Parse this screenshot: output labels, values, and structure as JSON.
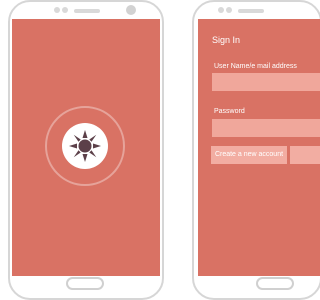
{
  "splash": {
    "logo_icon": "sun-icon"
  },
  "signin": {
    "title": "Sign In",
    "username_label": "User Name/e mail address",
    "username_value": "",
    "password_label": "Password",
    "password_value": "",
    "create_account_label": "Create a new account",
    "second_button_label": ""
  },
  "colors": {
    "screen_bg": "#d97264",
    "field_bg": "#f0a79b",
    "button_bg": "#f2ada2",
    "frame": "#d6d6d6"
  }
}
